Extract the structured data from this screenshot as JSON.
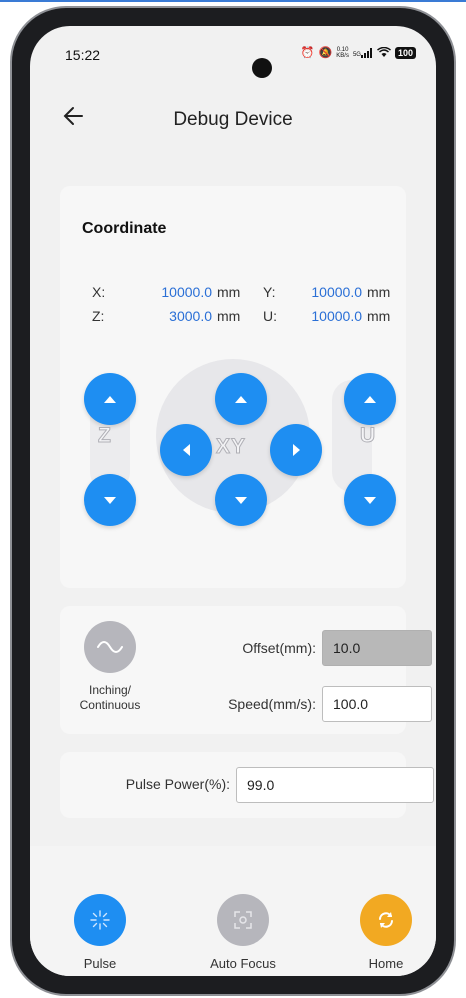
{
  "status_bar": {
    "time": "15:22",
    "net_speed_value": "0.10",
    "net_speed_unit": "KB/s",
    "network_type": "5G",
    "battery": "100"
  },
  "header": {
    "title": "Debug Device"
  },
  "coordinate": {
    "title": "Coordinate",
    "x_label": "X:",
    "x_value": "10000.0",
    "x_unit": "mm",
    "y_label": "Y:",
    "y_value": "10000.0",
    "y_unit": "mm",
    "z_label": "Z:",
    "z_value": "3000.0",
    "z_unit": "mm",
    "u_label": "U:",
    "u_value": "10000.0",
    "u_unit": "mm"
  },
  "jog": {
    "z_label": "Z",
    "xy_label": "XY",
    "u_label": "U"
  },
  "settings": {
    "mode_label": "Inching/ Continuous",
    "offset_label": "Offset(mm):",
    "offset_value": "10.0",
    "speed_label": "Speed(mm/s):",
    "speed_value": "100.0"
  },
  "pulse": {
    "label": "Pulse Power(%):",
    "value": "99.0"
  },
  "bottom": {
    "pulse_label": "Pulse",
    "autofocus_label": "Auto Focus",
    "home_label": "Home"
  },
  "colors": {
    "accent_blue": "#1e8ef2",
    "value_blue": "#2a6fd6",
    "home_orange": "#f2a922",
    "disabled_gray": "#b6b6bc"
  },
  "icons": [
    "back-arrow-icon",
    "sine-wave-icon",
    "pulse-burst-icon",
    "auto-focus-icon",
    "home-refresh-icon"
  ]
}
